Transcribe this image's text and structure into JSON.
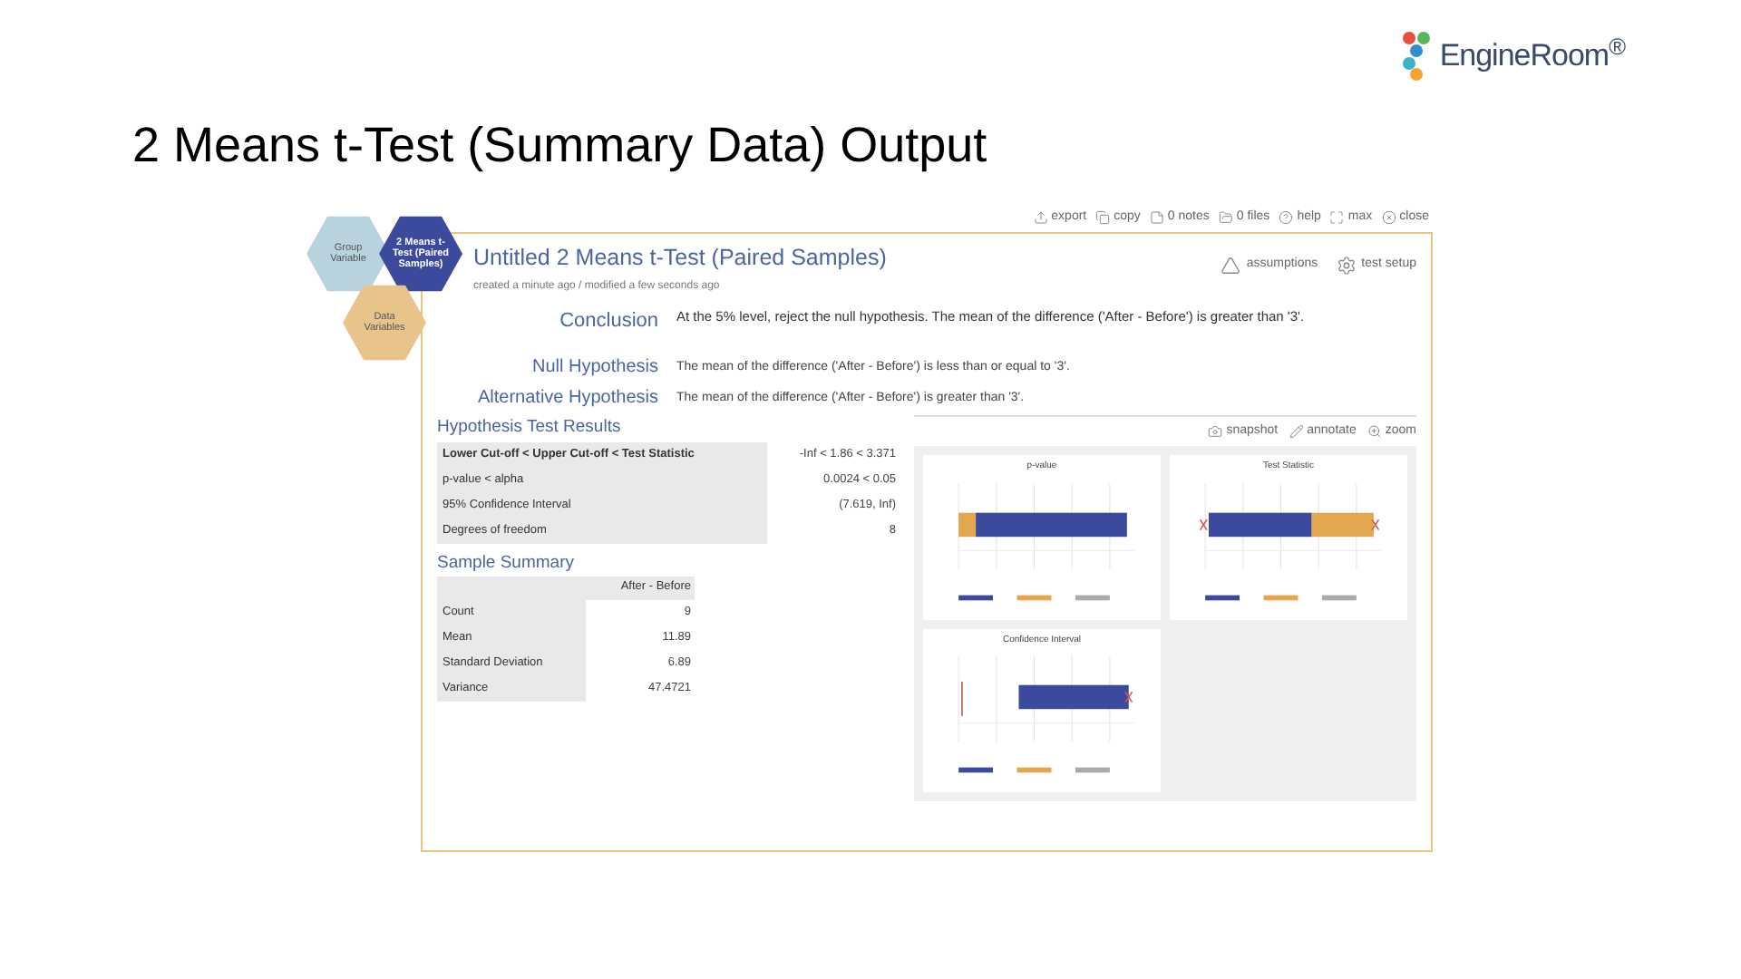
{
  "slide": {
    "title": "2 Means t-Test (Summary Data) Output",
    "logo": "EngineRoom$^{®}$"
  },
  "hexagons": [
    {
      "label": "Group Variable",
      "selected": false
    },
    {
      "label": "2 Means t-Test (Paired Samples)",
      "selected": true
    },
    {
      "label": "Data Variables",
      "selected": false
    }
  ],
  "toolbar": [
    {
      "kind": "export",
      "label": "export"
    },
    {
      "kind": "copy",
      "label": "copy"
    },
    {
      "kind": "notes",
      "label": "0 notes"
    },
    {
      "kind": "files",
      "label": "0 files"
    },
    {
      "kind": "help",
      "label": "help"
    },
    {
      "kind": "max",
      "label": "max"
    },
    {
      "kind": "close",
      "label": "close"
    }
  ],
  "analysis": {
    "title": "Untitled 2 Means t-Test (Paired Samples)",
    "meta": "created a minute ago / modified a few seconds ago",
    "actions": [
      {
        "kind": "assumptions",
        "label": "assumptions"
      },
      {
        "kind": "setup",
        "label": "test setup"
      }
    ],
    "conclusion": {
      "label": "Conclusion",
      "text": "At the 5% level, reject the null hypothesis. The mean of the difference ('After - Before') is greater than '3'."
    },
    "hypotheses": [
      {
        "label": "Null Hypothesis",
        "text": "The mean of the difference ('After - Before') is less than or equal to '3'."
      },
      {
        "label": "Alternative Hypothesis",
        "text": "The mean of the difference ('After - Before') is greater than '3'."
      }
    ]
  },
  "hypothesis_results": {
    "title": "Hypothesis Test Results",
    "rows": [
      {
        "label": "Lower Cut-off < Upper Cut-off < Test Statistic",
        "value": "-Inf < 1.86 < 3.371"
      },
      {
        "label": "p-value < alpha",
        "value": "0.0024 < 0.05"
      },
      {
        "label": "95% Confidence Interval",
        "value": "(7.619, Inf)"
      },
      {
        "label": "Degrees of freedom",
        "value": "8"
      }
    ]
  },
  "sample_summary": {
    "title": "Sample Summary",
    "column": "After - Before",
    "rows": [
      {
        "label": "Count",
        "value": "9"
      },
      {
        "label": "Mean",
        "value": "11.89"
      },
      {
        "label": "Standard Deviation",
        "value": "6.89"
      },
      {
        "label": "Variance",
        "value": "47.4721"
      }
    ]
  },
  "chart_tools": [
    {
      "kind": "snapshot",
      "label": "snapshot"
    },
    {
      "kind": "annotate",
      "label": "annotate"
    },
    {
      "kind": "zoom",
      "label": "zoom"
    }
  ],
  "charts": [
    {
      "kind": "pvalue",
      "title": "p-value"
    },
    {
      "kind": "statistic",
      "title": "Test Statistic"
    },
    {
      "kind": "interval",
      "title": "Confidence Interval"
    }
  ]
}
